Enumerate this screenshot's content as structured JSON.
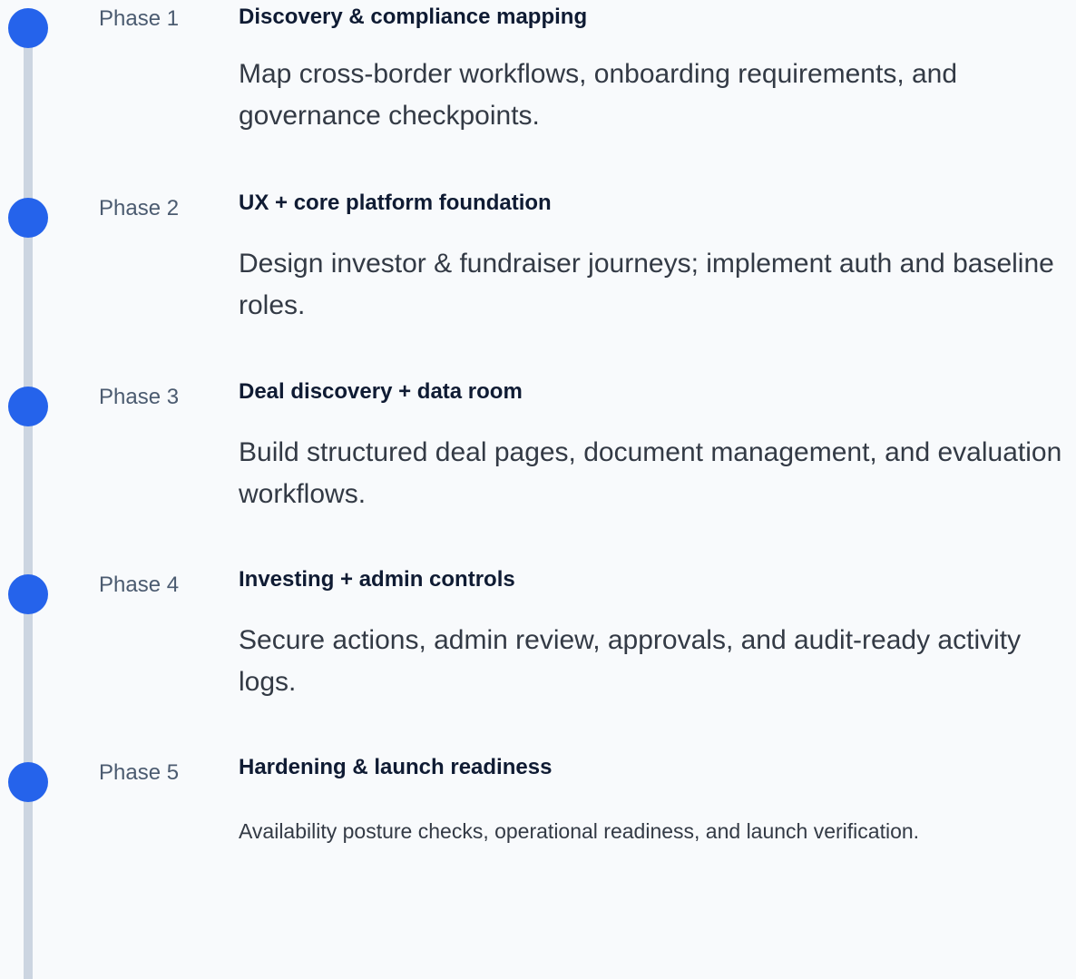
{
  "timeline": {
    "phases": [
      {
        "label": "Phase 1",
        "title": "Discovery & compliance mapping",
        "description": "Map cross-border workflows, onboarding requirements, and governance checkpoints."
      },
      {
        "label": "Phase 2",
        "title": "UX + core platform foundation",
        "description": "Design investor & fundraiser journeys; implement auth and baseline roles."
      },
      {
        "label": "Phase 3",
        "title": "Deal discovery + data room",
        "description": "Build structured deal pages, document management, and evaluation workflows."
      },
      {
        "label": "Phase 4",
        "title": "Investing + admin controls",
        "description": "Secure actions, admin review, approvals, and audit-ready activity logs."
      },
      {
        "label": "Phase 5",
        "title": "Hardening & launch readiness",
        "description": "Availability posture checks, operational readiness, and launch verification."
      }
    ]
  },
  "colors": {
    "accent": "#2563eb",
    "rail": "#ccd5e1",
    "background": "#f8fafc",
    "title": "#0f1b33",
    "label": "#4b5b70",
    "body": "#333a45"
  }
}
